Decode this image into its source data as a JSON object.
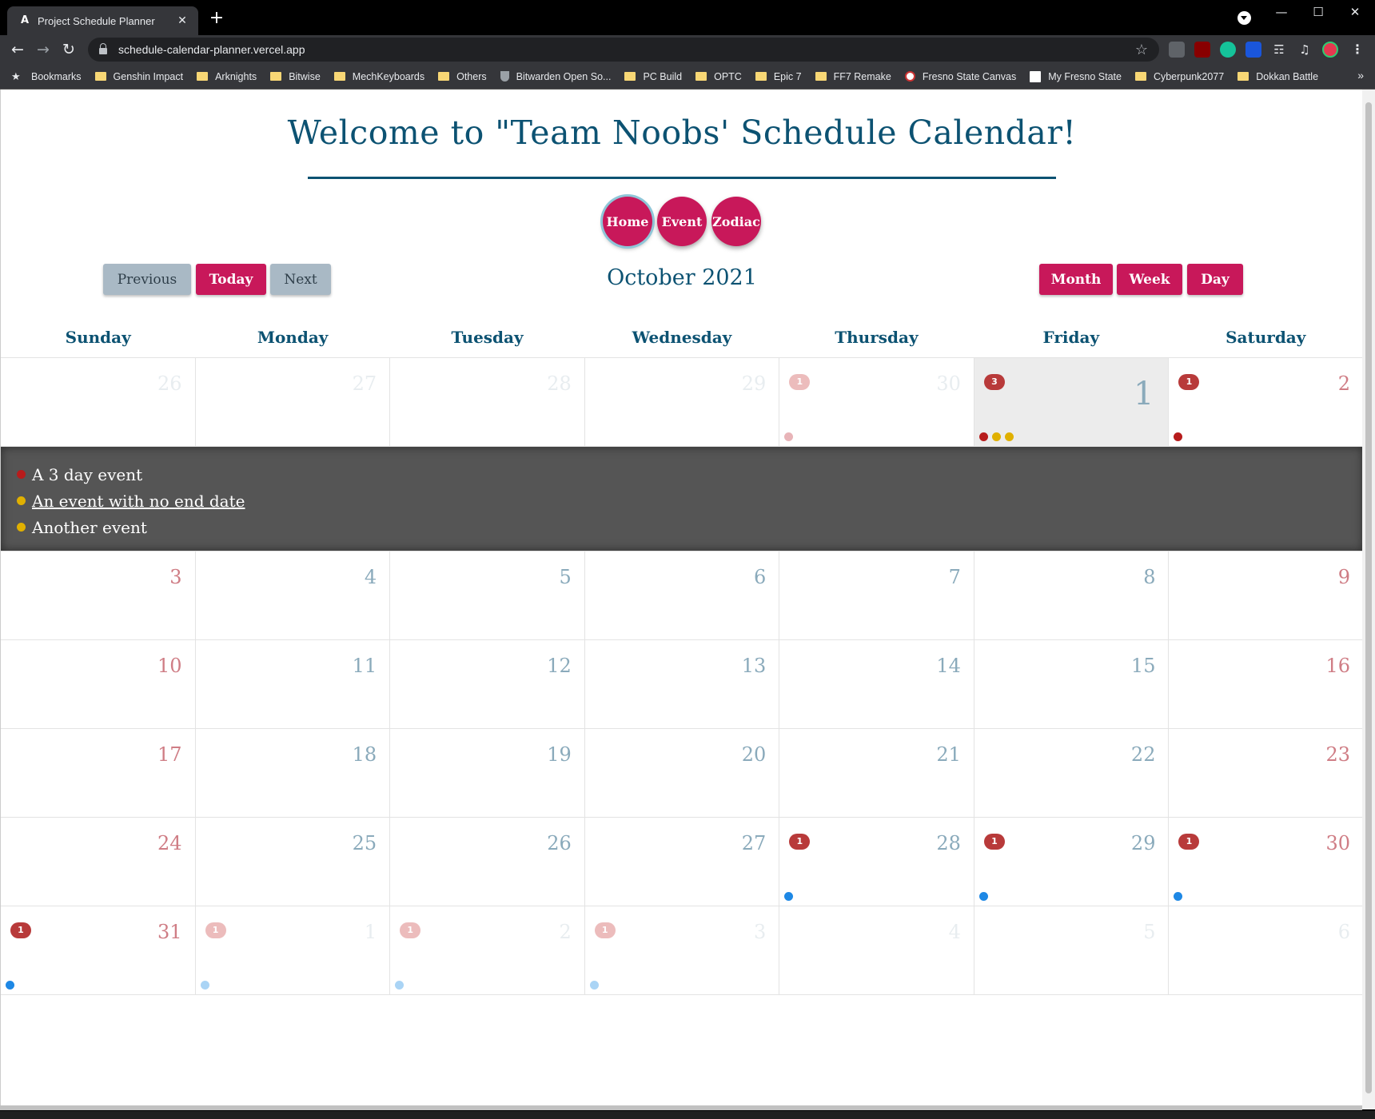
{
  "browser": {
    "tab_title": "Project Schedule Planner",
    "tab_favicon": "A",
    "tab_close": "✕",
    "new_tab": "+",
    "url": "schedule-calendar-planner.vercel.app",
    "bookmarks": [
      {
        "label": "Bookmarks",
        "icon": "star-icon"
      },
      {
        "label": "Genshin Impact",
        "icon": "folder-icon"
      },
      {
        "label": "Arknights",
        "icon": "folder-icon"
      },
      {
        "label": "Bitwise",
        "icon": "folder-icon"
      },
      {
        "label": "MechKeyboards",
        "icon": "folder-icon"
      },
      {
        "label": "Others",
        "icon": "folder-icon"
      },
      {
        "label": "Bitwarden Open So...",
        "icon": "shield-icon"
      },
      {
        "label": "PC Build",
        "icon": "folder-icon"
      },
      {
        "label": "OPTC",
        "icon": "folder-icon"
      },
      {
        "label": "Epic 7",
        "icon": "folder-icon"
      },
      {
        "label": "FF7 Remake",
        "icon": "folder-icon"
      },
      {
        "label": "Fresno State Canvas",
        "icon": "canvas-icon"
      },
      {
        "label": "My Fresno State",
        "icon": "fresno-icon"
      },
      {
        "label": "Cyberpunk2077",
        "icon": "folder-icon"
      },
      {
        "label": "Dokkan Battle",
        "icon": "folder-icon"
      }
    ]
  },
  "header": {
    "title": "Welcome to \"Team Noobs' Schedule Calendar!"
  },
  "nav": {
    "home": "Home",
    "event": "Event",
    "zodiac": "Zodiac"
  },
  "toolbar": {
    "previous": "Previous",
    "today": "Today",
    "next": "Next",
    "month_title": "October 2021",
    "month": "Month",
    "week": "Week",
    "day": "Day"
  },
  "weekdays": [
    "Sunday",
    "Monday",
    "Tuesday",
    "Wednesday",
    "Thursday",
    "Friday",
    "Saturday"
  ],
  "colors": {
    "accent": "#c8185a",
    "heading": "#0c5272",
    "event_red": "#b71c1c",
    "event_yellow": "#e0b000",
    "event_blue": "#1e88e5",
    "event_blue_faded": "#aad4f5",
    "event_pink_faded": "#e8b4b8"
  },
  "weeks": [
    [
      {
        "num": "26",
        "kind": "other"
      },
      {
        "num": "27",
        "kind": "other"
      },
      {
        "num": "28",
        "kind": "other"
      },
      {
        "num": "29",
        "kind": "other"
      },
      {
        "num": "30",
        "kind": "other",
        "badge": "1",
        "badge_style": "faded",
        "dots": [
          "#e8b4b8"
        ]
      },
      {
        "num": "1",
        "kind": "today",
        "badge": "3",
        "badge_style": "strong",
        "dots": [
          "#b71c1c",
          "#e0b000",
          "#e0b000"
        ]
      },
      {
        "num": "2",
        "kind": "weekend",
        "badge": "1",
        "badge_style": "strong",
        "dots": [
          "#b71c1c"
        ]
      }
    ],
    [
      {
        "num": "3",
        "kind": "weekend"
      },
      {
        "num": "4",
        "kind": "weekday"
      },
      {
        "num": "5",
        "kind": "weekday"
      },
      {
        "num": "6",
        "kind": "weekday"
      },
      {
        "num": "7",
        "kind": "weekday"
      },
      {
        "num": "8",
        "kind": "weekday"
      },
      {
        "num": "9",
        "kind": "weekend"
      }
    ],
    [
      {
        "num": "10",
        "kind": "weekend"
      },
      {
        "num": "11",
        "kind": "weekday"
      },
      {
        "num": "12",
        "kind": "weekday"
      },
      {
        "num": "13",
        "kind": "weekday"
      },
      {
        "num": "14",
        "kind": "weekday"
      },
      {
        "num": "15",
        "kind": "weekday"
      },
      {
        "num": "16",
        "kind": "weekend"
      }
    ],
    [
      {
        "num": "17",
        "kind": "weekend"
      },
      {
        "num": "18",
        "kind": "weekday"
      },
      {
        "num": "19",
        "kind": "weekday"
      },
      {
        "num": "20",
        "kind": "weekday"
      },
      {
        "num": "21",
        "kind": "weekday"
      },
      {
        "num": "22",
        "kind": "weekday"
      },
      {
        "num": "23",
        "kind": "weekend"
      }
    ],
    [
      {
        "num": "24",
        "kind": "weekend"
      },
      {
        "num": "25",
        "kind": "weekday"
      },
      {
        "num": "26",
        "kind": "weekday"
      },
      {
        "num": "27",
        "kind": "weekday"
      },
      {
        "num": "28",
        "kind": "weekday",
        "badge": "1",
        "badge_style": "strong",
        "dots": [
          "#1e88e5"
        ]
      },
      {
        "num": "29",
        "kind": "weekday",
        "badge": "1",
        "badge_style": "strong",
        "dots": [
          "#1e88e5"
        ]
      },
      {
        "num": "30",
        "kind": "weekend",
        "badge": "1",
        "badge_style": "strong",
        "dots": [
          "#1e88e5"
        ]
      }
    ],
    [
      {
        "num": "31",
        "kind": "weekend",
        "badge": "1",
        "badge_style": "strong",
        "dots": [
          "#1e88e5"
        ]
      },
      {
        "num": "1",
        "kind": "other",
        "badge": "1",
        "badge_style": "faded",
        "dots": [
          "#aad4f5"
        ]
      },
      {
        "num": "2",
        "kind": "other",
        "badge": "1",
        "badge_style": "faded",
        "dots": [
          "#aad4f5"
        ]
      },
      {
        "num": "3",
        "kind": "other",
        "badge": "1",
        "badge_style": "faded",
        "dots": [
          "#aad4f5"
        ]
      },
      {
        "num": "4",
        "kind": "other"
      },
      {
        "num": "5",
        "kind": "other"
      },
      {
        "num": "6",
        "kind": "other"
      }
    ]
  ],
  "selected_day_events": [
    {
      "title": "A 3 day event",
      "color": "#b71c1c",
      "link": false
    },
    {
      "title": "An event with no end date",
      "color": "#e0b000",
      "link": true
    },
    {
      "title": "Another event",
      "color": "#e0b000",
      "link": false
    }
  ]
}
